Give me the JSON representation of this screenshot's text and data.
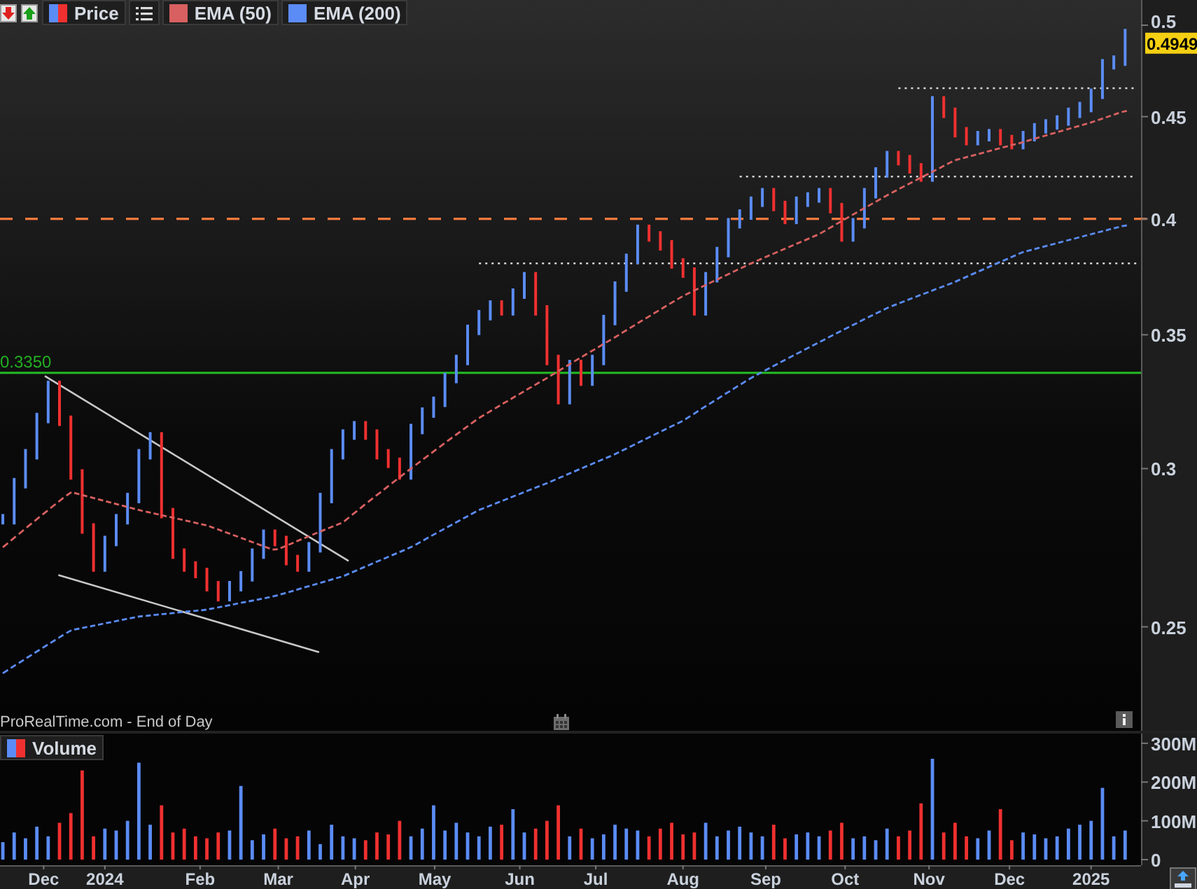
{
  "price_chart": {
    "legend": [
      {
        "label": "Price",
        "kind": "price",
        "color": "#5b8cf5"
      },
      {
        "label": "EMA (50)",
        "kind": "average",
        "color": "#d86060"
      },
      {
        "label": "EMA (200)",
        "kind": "average",
        "color": "#5b8cf5"
      }
    ],
    "level_label": "0.3350",
    "price_axis": [
      "0.5",
      "0.45",
      "0.4",
      "0.35",
      "0.3",
      "0.25"
    ],
    "last_price": "0.4949",
    "source_label": "ProRealTime.com - End of Day"
  },
  "volume_chart": {
    "legend": {
      "label": "Volume",
      "kind": "price",
      "color": "#5b8cf5"
    },
    "volume_axis": [
      "300M",
      "200M",
      "100M",
      "0"
    ]
  },
  "date_axis": [
    "Dec",
    "2024",
    "Feb",
    "Mar",
    "Apr",
    "May",
    "Jun",
    "Jul",
    "Aug",
    "Sep",
    "Oct",
    "Nov",
    "Dec",
    "2025"
  ]
}
